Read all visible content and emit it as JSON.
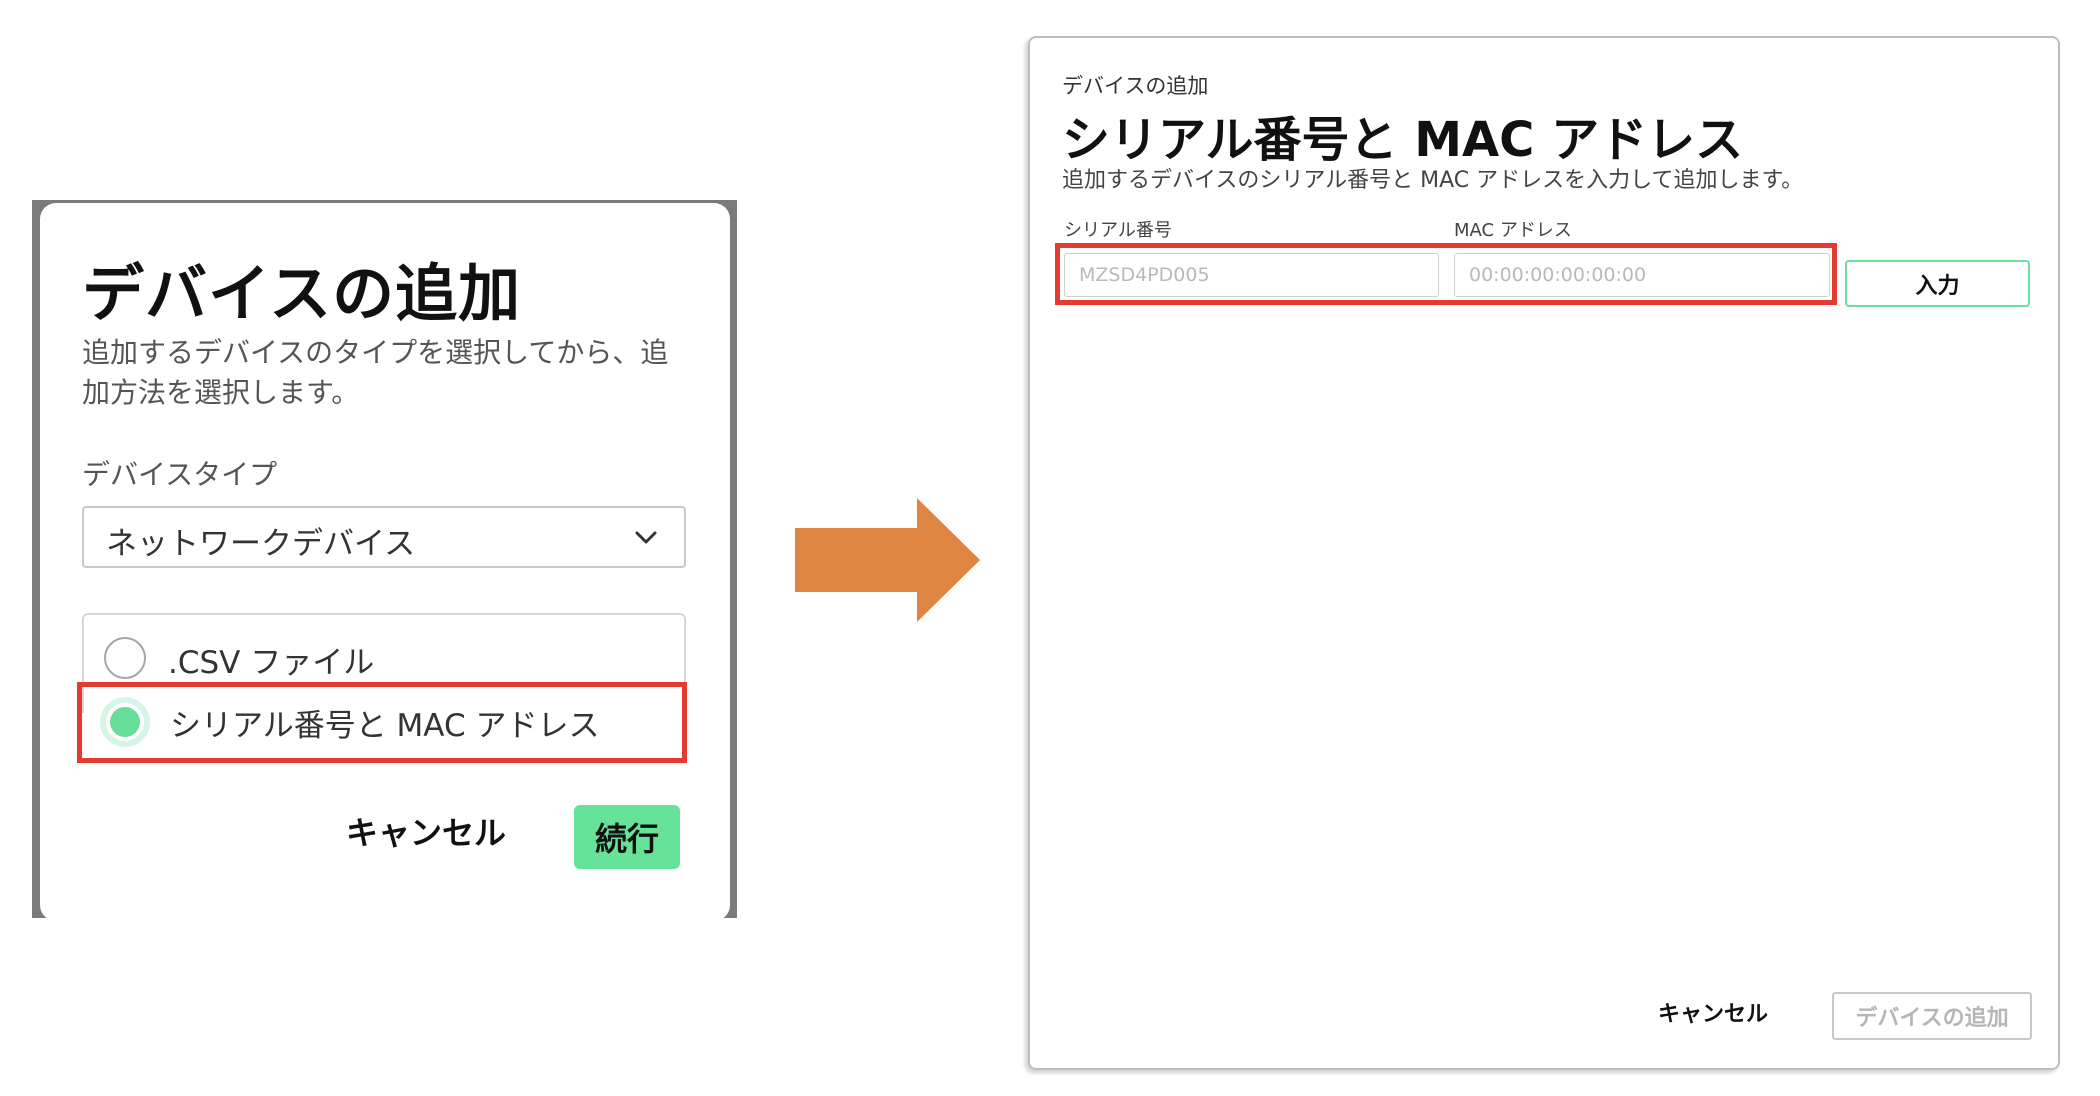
{
  "left_dialog": {
    "title": "デバイスの追加",
    "description": "追加するデバイスのタイプを選択してから、追加方法を選択します。",
    "device_type_label": "デバイスタイプ",
    "device_type_selected": "ネットワークデバイス",
    "add_methods": [
      {
        "label": ".CSV ファイル",
        "selected": false
      },
      {
        "label": "シリアル番号と MAC アドレス",
        "selected": true
      }
    ],
    "cancel_label": "キャンセル",
    "continue_label": "続行"
  },
  "right_dialog": {
    "breadcrumb": "デバイスの追加",
    "title": "シリアル番号と MAC アドレス",
    "description": "追加するデバイスのシリアル番号と MAC アドレスを入力して追加します。",
    "serial_field": {
      "label": "シリアル番号",
      "placeholder": "MZSD4PD005"
    },
    "mac_field": {
      "label": "MAC アドレス",
      "placeholder": "00:00:00:00:00:00"
    },
    "enter_label": "入力",
    "cancel_label": "キャンセル",
    "add_device_label": "デバイスの追加"
  },
  "colors": {
    "accent_green": "#66e299",
    "highlight_red": "#e53a2f",
    "arrow_orange": "#e08442"
  },
  "icons": {
    "select_chevron": "chevron-down-icon",
    "flow_arrow": "arrow-right-icon"
  }
}
